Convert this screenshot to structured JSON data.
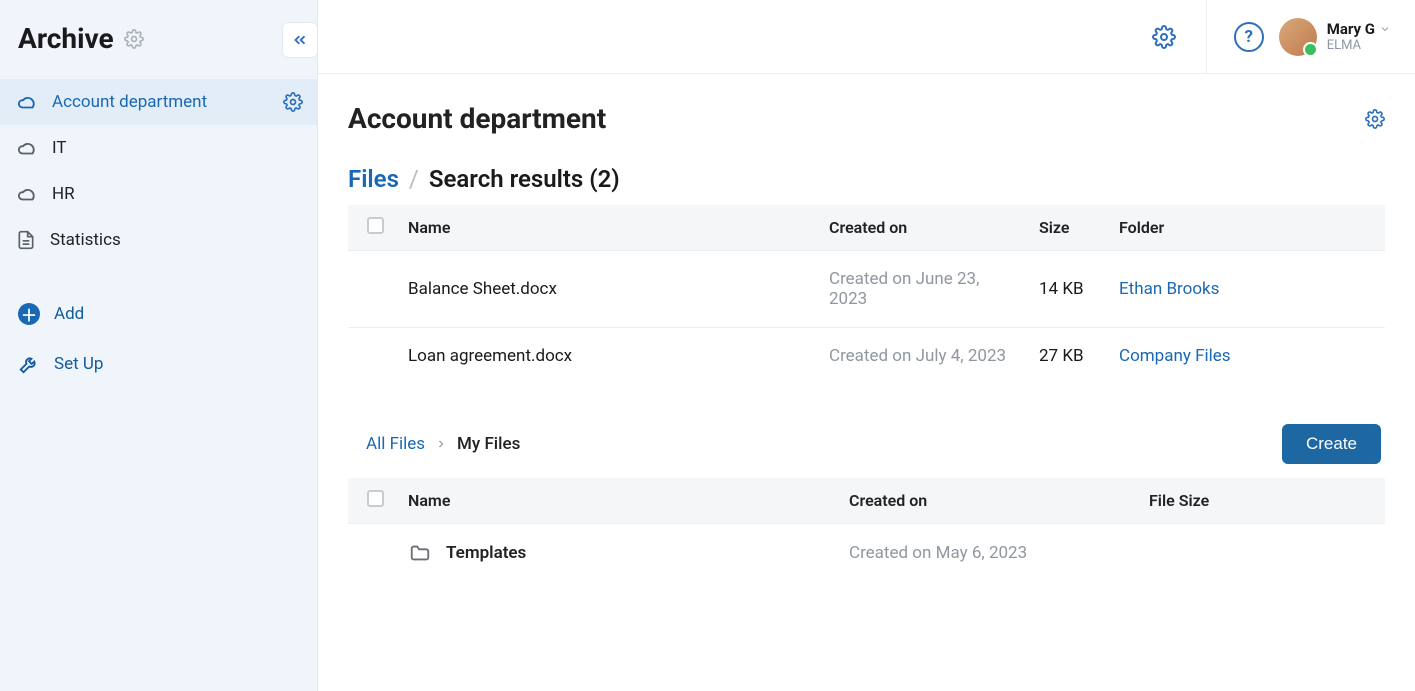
{
  "sidebar": {
    "title": "Archive",
    "items": [
      {
        "label": "Account department",
        "icon": "cloud",
        "active": true
      },
      {
        "label": "IT",
        "icon": "cloud",
        "active": false
      },
      {
        "label": "HR",
        "icon": "cloud",
        "active": false
      },
      {
        "label": "Statistics",
        "icon": "document",
        "active": false
      }
    ],
    "actions": {
      "add": "Add",
      "setup": "Set Up"
    }
  },
  "topbar": {
    "user_name": "Mary G",
    "user_org": "ELMA"
  },
  "page": {
    "title": "Account department",
    "files_label": "Files",
    "results_label": "Search results (2)"
  },
  "table1": {
    "cols": {
      "name": "Name",
      "created": "Created on",
      "size": "Size",
      "folder": "Folder"
    },
    "rows": [
      {
        "name": "Balance Sheet.docx",
        "created": "Created on June 23, 2023",
        "size": "14 KB",
        "folder": "Ethan Brooks"
      },
      {
        "name": "Loan agreement.docx",
        "created": "Created on July 4, 2023",
        "size": "27 KB",
        "folder": "Company Files"
      }
    ]
  },
  "section2": {
    "breadcrumb": {
      "root": "All Files",
      "current": "My Files"
    },
    "create_label": "Create",
    "cols": {
      "name": "Name",
      "created": "Created on",
      "size": "File Size"
    },
    "rows": [
      {
        "name": "Templates",
        "created": "Created on May 6, 2023",
        "size": ""
      }
    ]
  }
}
